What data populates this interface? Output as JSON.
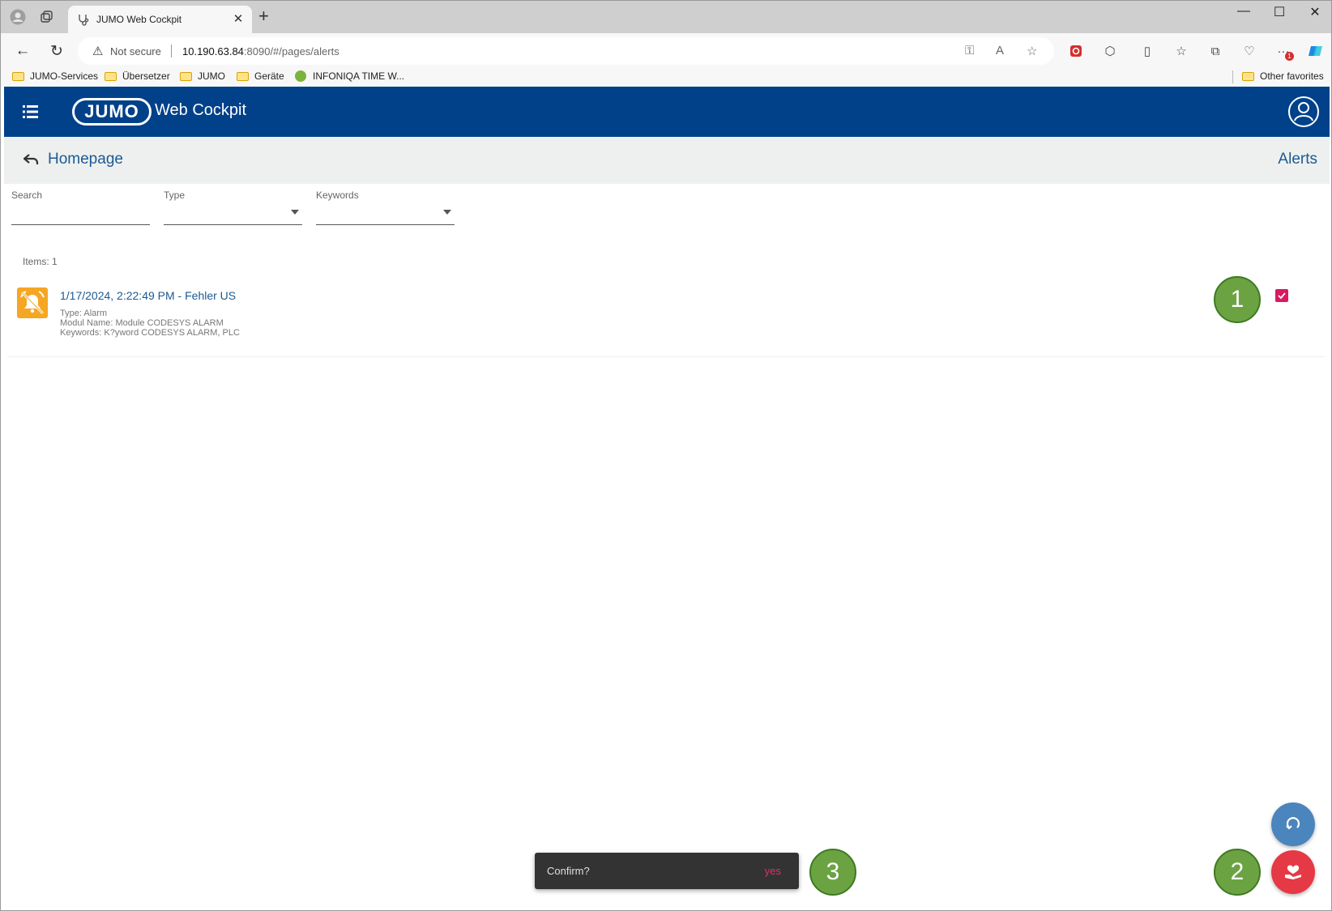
{
  "browser": {
    "tab_title": "JUMO Web Cockpit",
    "url_warning": "Not secure",
    "url_host": "10.190.63.84",
    "url_rest": ":8090/#/pages/alerts",
    "bookmarks": [
      "JUMO-Services",
      "Übersetzer",
      "JUMO",
      "Geräte",
      "INFONIQA TIME W..."
    ],
    "other_favorites": "Other favorites",
    "extension_badge": "1"
  },
  "app": {
    "logo_text": "JUMO",
    "title": "Web Cockpit",
    "brand_color": "#01418a"
  },
  "breadcrumb": {
    "back_label": "Homepage",
    "page_title": "Alerts"
  },
  "filters": {
    "search_label": "Search",
    "type_label": "Type",
    "keywords_label": "Keywords"
  },
  "list": {
    "items_count": "Items: 1",
    "alerts": [
      {
        "title": "1/17/2024, 2:22:49 PM - Fehler US",
        "type": "Type: Alarm",
        "module": "Modul Name: Module CODESYS ALARM",
        "keywords": "Keywords: K?yword CODESYS ALARM, PLC",
        "checked": true
      }
    ]
  },
  "snackbar": {
    "message": "Confirm?",
    "action": "yes"
  },
  "callouts": [
    "1",
    "2",
    "3"
  ]
}
